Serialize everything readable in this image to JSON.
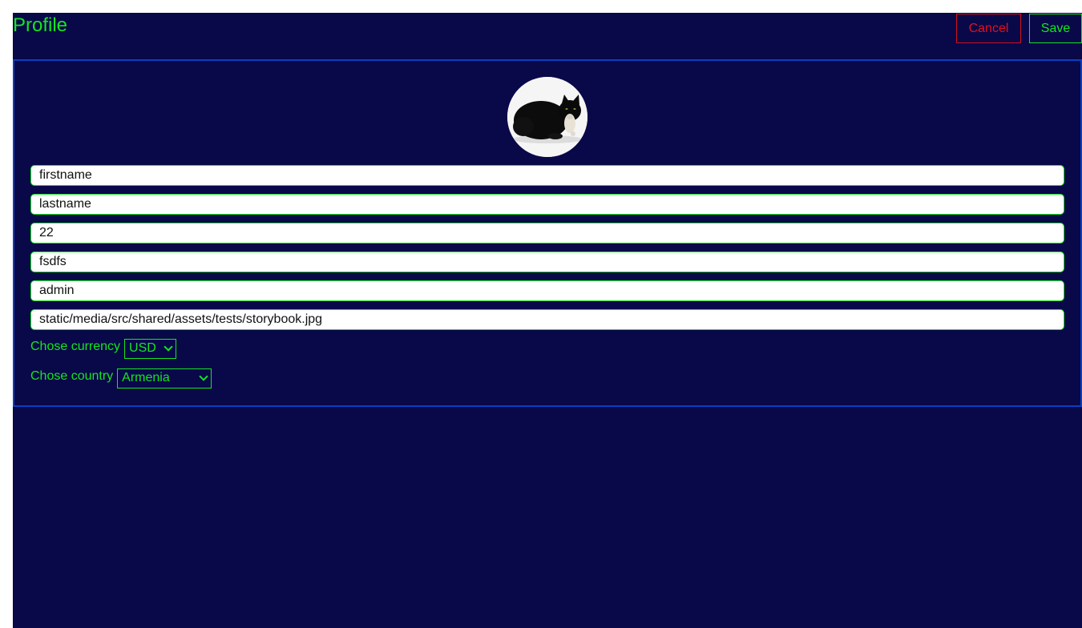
{
  "header": {
    "title": "Profile",
    "cancel_label": "Cancel",
    "save_label": "Save"
  },
  "avatar": {
    "alt": "cat avatar"
  },
  "form": {
    "firstname": "firstname",
    "lastname": "lastname",
    "age": "22",
    "city": "fsdfs",
    "username": "admin",
    "avatar_path": "static/media/src/shared/assets/tests/storybook.jpg",
    "currency_label": "Chose currency",
    "currency_value": "USD",
    "country_label": "Chose country",
    "country_value": "Armenia"
  },
  "colors": {
    "background": "#090849",
    "accent": "#14e620",
    "danger": "#e0101e",
    "card_border": "#0a3fbf"
  }
}
